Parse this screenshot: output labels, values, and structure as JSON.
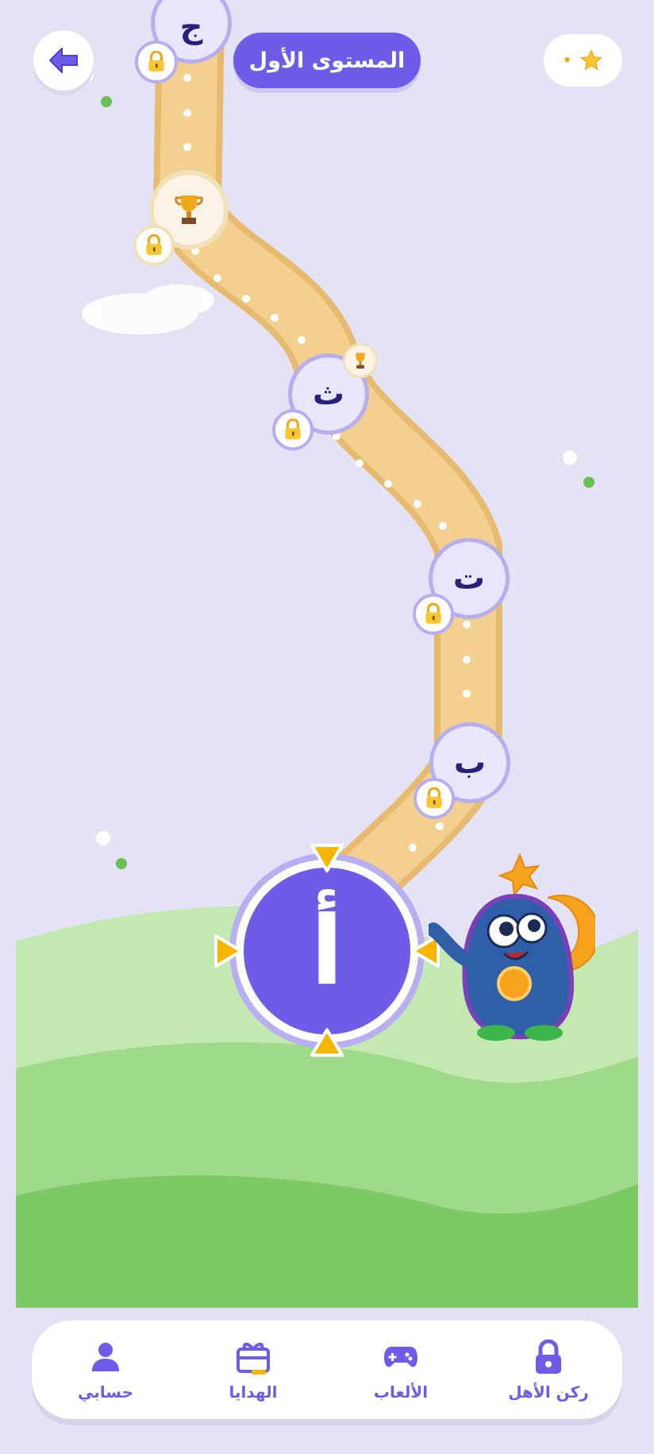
{
  "header": {
    "title": "المستوى الأول",
    "stars_count": "•"
  },
  "levels": [
    {
      "letter": "ج",
      "state": "locked"
    },
    {
      "letter": "ث",
      "state": "locked"
    },
    {
      "letter": "ت",
      "state": "locked"
    },
    {
      "letter": "ب",
      "state": "locked"
    }
  ],
  "current_level": {
    "letter": "أ"
  },
  "bottom_nav": [
    {
      "label": "ركن الأهل",
      "icon": "lock-icon"
    },
    {
      "label": "الألعاب",
      "icon": "gamepad-icon"
    },
    {
      "label": "الهدايا",
      "icon": "gift-icon"
    },
    {
      "label": "حسابي",
      "icon": "user-icon"
    }
  ],
  "colors": {
    "accent": "#6c5ce7",
    "background": "#e4e2f5",
    "path": "#f3d08f",
    "grass_light": "#c3e8b0",
    "grass_mid": "#9fd98a",
    "grass_dark": "#7dc965",
    "arrow": "#f7b500"
  }
}
